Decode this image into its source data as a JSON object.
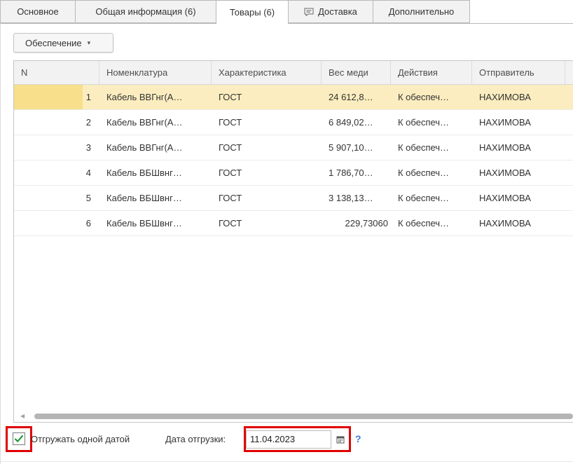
{
  "tabs": [
    {
      "label": "Основное",
      "active": false
    },
    {
      "label": "Общая информация (6)",
      "active": false
    },
    {
      "label": "Товары (6)",
      "active": true
    },
    {
      "label": "Доставка",
      "active": false,
      "icon": "comment-icon"
    },
    {
      "label": "Дополнительно",
      "active": false
    }
  ],
  "toolbar": {
    "provision_button": "Обеспечение",
    "provision_caret": "▾"
  },
  "table": {
    "columns": [
      "N",
      "Номенклатура",
      "Характеристика",
      "Вес меди",
      "Действия",
      "Отправитель"
    ],
    "rows": [
      {
        "n": "1",
        "nomenclature": "Кабель ВВГнг(А…",
        "characteristic": "ГОСТ",
        "copper_weight": "24 612,8…",
        "action": "К обеспеч…",
        "sender": "НАХИМОВА",
        "selected": true
      },
      {
        "n": "2",
        "nomenclature": "Кабель ВВГнг(А…",
        "characteristic": "ГОСТ",
        "copper_weight": "6 849,02…",
        "action": "К обеспеч…",
        "sender": "НАХИМОВА",
        "selected": false
      },
      {
        "n": "3",
        "nomenclature": "Кабель ВВГнг(А…",
        "characteristic": "ГОСТ",
        "copper_weight": "5 907,10…",
        "action": "К обеспеч…",
        "sender": "НАХИМОВА",
        "selected": false
      },
      {
        "n": "4",
        "nomenclature": "Кабель ВБШвнг…",
        "characteristic": "ГОСТ",
        "copper_weight": "1 786,70…",
        "action": "К обеспеч…",
        "sender": "НАХИМОВА",
        "selected": false
      },
      {
        "n": "5",
        "nomenclature": "Кабель ВБШвнг…",
        "characteristic": "ГОСТ",
        "copper_weight": "3 138,13…",
        "action": "К обеспеч…",
        "sender": "НАХИМОВА",
        "selected": false
      },
      {
        "n": "6",
        "nomenclature": "Кабель ВБШвнг…",
        "characteristic": "ГОСТ",
        "copper_weight": "229,73060",
        "action": "К обеспеч…",
        "sender": "НАХИМОВА",
        "selected": false
      }
    ]
  },
  "footer": {
    "ship_one_date_label": "Отгружать одной датой",
    "ship_one_date_checked": true,
    "ship_date_label": "Дата отгрузки:",
    "ship_date_value": "11.04.2023",
    "help_label": "?"
  },
  "colors": {
    "selected_row": "#fbedbf",
    "selected_marker": "#f7df8c",
    "highlight_frame": "#e00000",
    "checkmark": "#1f9c3a",
    "help": "#3a7bd5"
  }
}
